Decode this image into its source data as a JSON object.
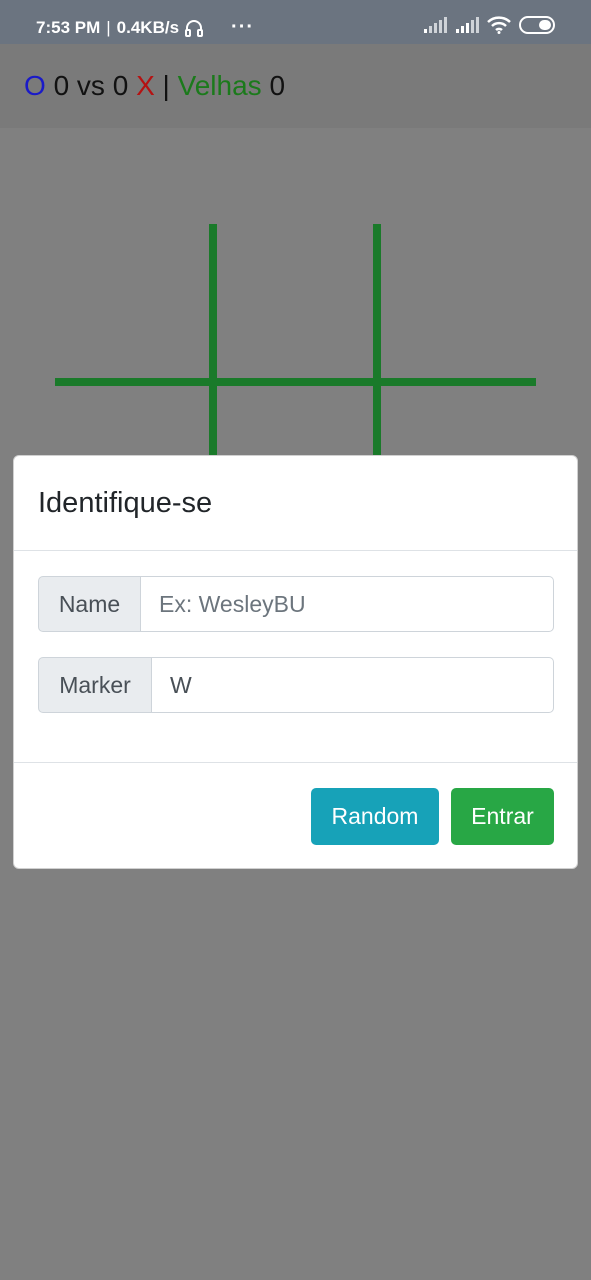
{
  "status_bar": {
    "time": "7:53 PM",
    "separator": "|",
    "speed": "0.4KB/s",
    "more": "···",
    "icons": [
      "headphones-icon",
      "signal-icon",
      "signal-icon",
      "wifi-icon",
      "battery-icon"
    ]
  },
  "score": {
    "o_label": "O",
    "o_score": "0",
    "vs": "vs",
    "x_score": "0",
    "x_label": "X",
    "separator": "|",
    "velhas_label": "Velhas",
    "velhas_score": "0"
  },
  "modal": {
    "title": "Identifique-se",
    "name_label": "Name",
    "name_placeholder": "Ex: WesleyBU",
    "marker_label": "Marker",
    "marker_value": "W",
    "random_button": "Random",
    "enter_button": "Entrar"
  },
  "colors": {
    "o_mark": "#1a1ac8",
    "x_mark": "#b51212",
    "velhas": "#1b7a1b",
    "board_lines": "#1a7a2a",
    "random_button": "#17a2b8",
    "enter_button": "#28a745"
  }
}
